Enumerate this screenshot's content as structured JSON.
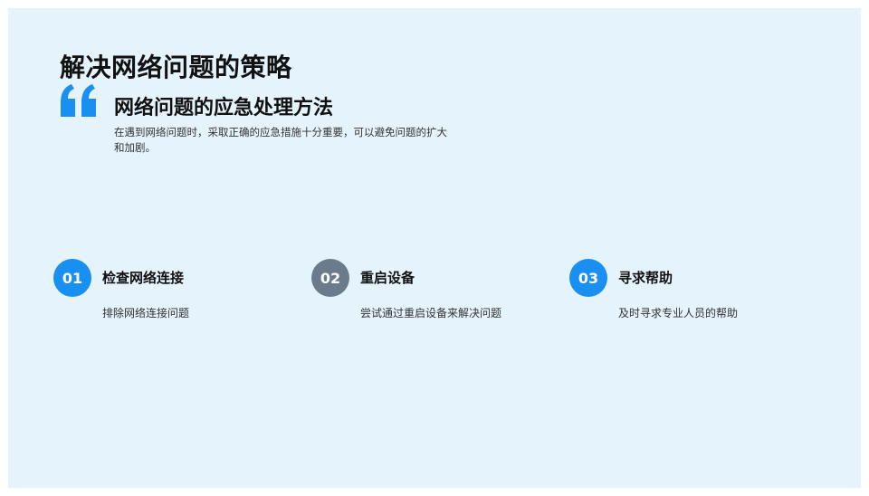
{
  "title": "解决网络问题的策略",
  "subtitle": "网络问题的应急处理方法",
  "description": "在遇到网络问题时，采取正确的应急措施十分重要，可以避免问题的扩大和加剧。",
  "quote_icon": "quote-icon",
  "colors": {
    "background": "#e5f3fc",
    "accent": "#1a8ff2",
    "gray": "#6b7b8c"
  },
  "steps": [
    {
      "number": "01",
      "title": "检查网络连接",
      "description": "排除网络连接问题",
      "color": "#1a8ff2"
    },
    {
      "number": "02",
      "title": "重启设备",
      "description": "尝试通过重启设备来解决问题",
      "color": "#6b7b8c"
    },
    {
      "number": "03",
      "title": "寻求帮助",
      "description": "及时寻求专业人员的帮助",
      "color": "#1a8ff2"
    }
  ]
}
